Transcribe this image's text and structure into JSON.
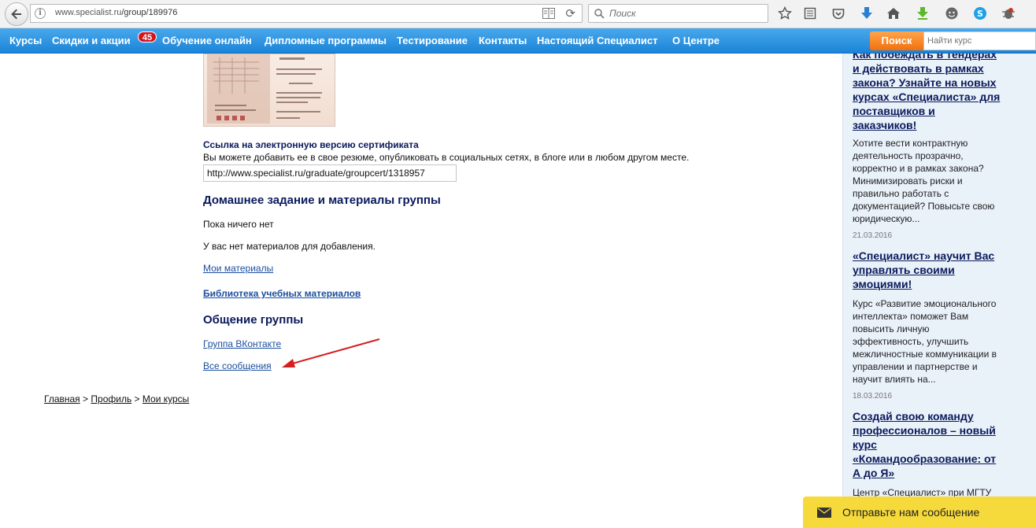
{
  "browser": {
    "url_host": "www.specialist.ru",
    "url_path": "/group/189976",
    "search_placeholder": "Поиск"
  },
  "nav": {
    "items": [
      "Курсы",
      "Скидки и акции",
      "Обучение онлайн",
      "Дипломные программы",
      "Тестирование",
      "Контакты",
      "Настоящий Специалист",
      "О Центре"
    ],
    "badge": "45",
    "search_button": "Поиск",
    "search_placeholder": "Найти курс"
  },
  "main": {
    "cert_link_heading": "Ссылка на электронную версию сертификата",
    "cert_link_desc": "Вы можете добавить ее в свое резюме, опубликовать в социальных сетях, в блоге или в любом другом месте.",
    "cert_url": "http://www.specialist.ru/graduate/groupcert/1318957",
    "homework_heading": "Домашнее задание и материалы группы",
    "nothing_yet": "Пока ничего нет",
    "no_materials": "У вас нет материалов для добавления.",
    "my_materials": "Мои материалы",
    "library": "Библиотека учебных материалов",
    "group_comm_heading": "Общение группы",
    "vk_group": "Группа ВКонтакте",
    "all_messages": "Все сообщения"
  },
  "breadcrumb": {
    "home": "Главная",
    "profile": "Профиль",
    "my_courses": "Мои курсы",
    "sep": ">"
  },
  "sidebar": {
    "news": [
      {
        "title_lines": [
          "Как побеждать в тендерах",
          "и действовать в рамках",
          "закона? Узнайте на новых",
          "курсах «Специалиста» для",
          "поставщиков и",
          "заказчиков!"
        ],
        "body_lines": [
          "Хотите вести контрактную",
          "деятельность прозрачно,",
          "корректно и в рамках закона?",
          "Минимизировать риски и",
          "правильно работать с",
          "документацией? Повысьте свою",
          "юридическую..."
        ],
        "date": "21.03.2016"
      },
      {
        "title_lines": [
          "«Специалист» научит Вас",
          "управлять своими",
          "эмоциями!"
        ],
        "body_lines": [
          "Курс «Развитие эмоционального",
          "интеллекта» поможет Вам",
          "повысить личную",
          "эффективность, улучшить",
          "межличностные коммуникации в",
          "управлении и партнерстве и",
          "научит влиять на..."
        ],
        "date": "18.03.2016"
      },
      {
        "title_lines": [
          "Создай свою команду",
          "профессионалов – новый",
          "курс",
          "«Командообразование: от",
          "А до Я»"
        ],
        "body_lines": [
          "Центр «Специалист» при МГТУ"
        ]
      }
    ]
  },
  "feedback": {
    "label": "Отправьте нам сообщение"
  },
  "colors": {
    "nav_blue": "#1a84d8",
    "search_orange": "#f36f0c",
    "heading_navy": "#0a1a5c",
    "link_blue": "#1a4e9e",
    "feedback_yellow": "#f6d93a",
    "arrow_red": "#d42020"
  }
}
